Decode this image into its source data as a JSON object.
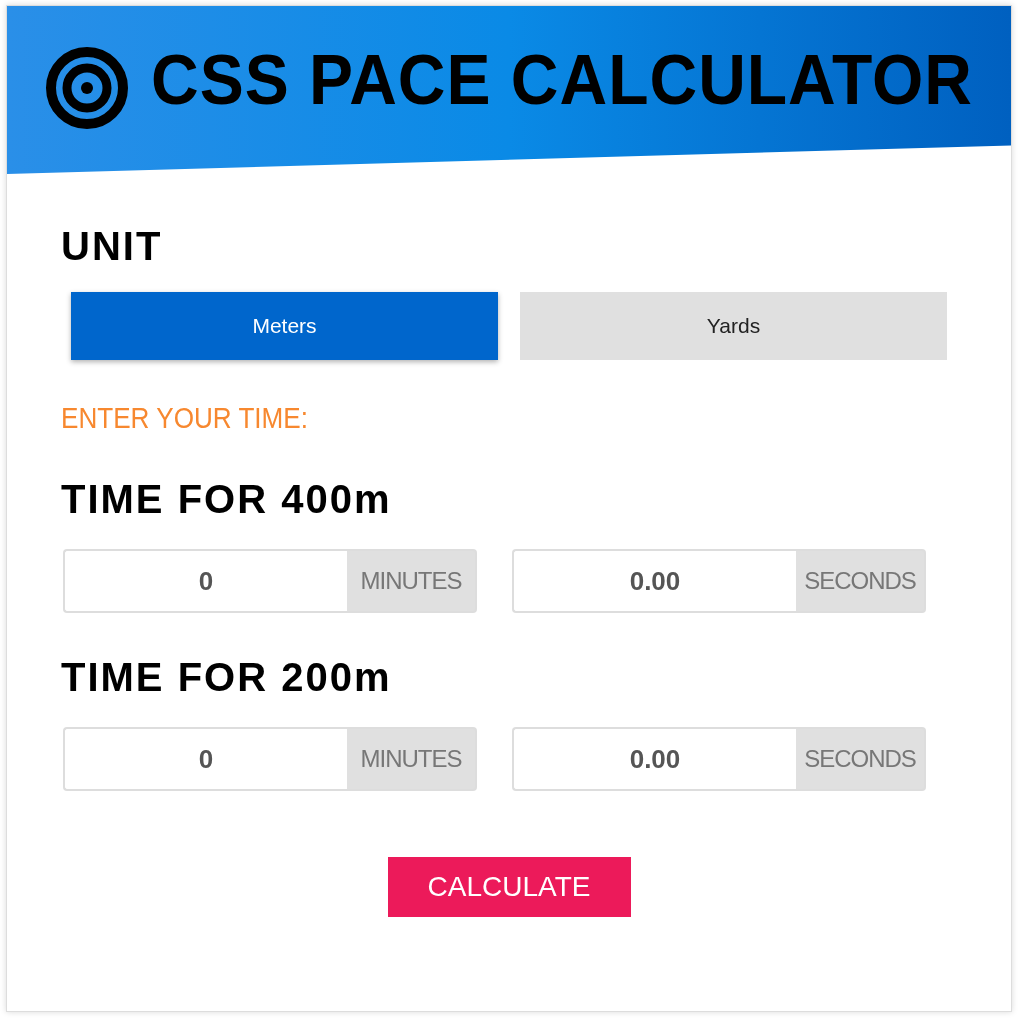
{
  "header": {
    "title": "CSS PACE CALCULATOR"
  },
  "unit": {
    "label": "UNIT",
    "options": [
      {
        "label": "Meters",
        "selected": true
      },
      {
        "label": "Yards",
        "selected": false
      }
    ]
  },
  "prompt": "ENTER YOUR TIME:",
  "sections": [
    {
      "heading": "TIME FOR 400m",
      "fields": [
        {
          "value": "0",
          "unit": "MINUTES"
        },
        {
          "value": "0.00",
          "unit": "SECONDS"
        }
      ]
    },
    {
      "heading": "TIME FOR 200m",
      "fields": [
        {
          "value": "0",
          "unit": "MINUTES"
        },
        {
          "value": "0.00",
          "unit": "SECONDS"
        }
      ]
    }
  ],
  "button": "CALCULATE"
}
